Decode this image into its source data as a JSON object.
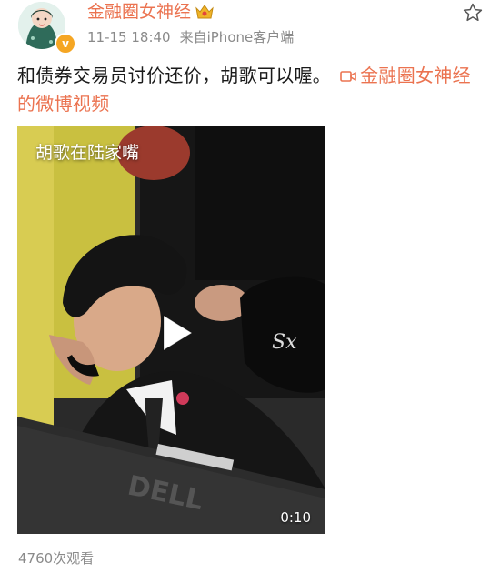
{
  "post": {
    "username": "金融圈女神经",
    "timestamp": "11-15 18:40",
    "source": "来自iPhone客户端",
    "text": "和债券交易员讨价还价，胡歌可以喔。",
    "video_link_text": "金融圈女神经的微博视频",
    "view_count": "4760次观看"
  },
  "video": {
    "overlay_title": "胡歌在陆家嘴",
    "duration": "0:10"
  },
  "colors": {
    "accent": "#eb7350",
    "verify": "#f5a623",
    "meta_gray": "#8a8a8a"
  },
  "icons": {
    "crown": "crown-icon",
    "star": "star-icon",
    "video": "video-icon",
    "play": "play-icon",
    "verify": "verified-badge-icon"
  }
}
